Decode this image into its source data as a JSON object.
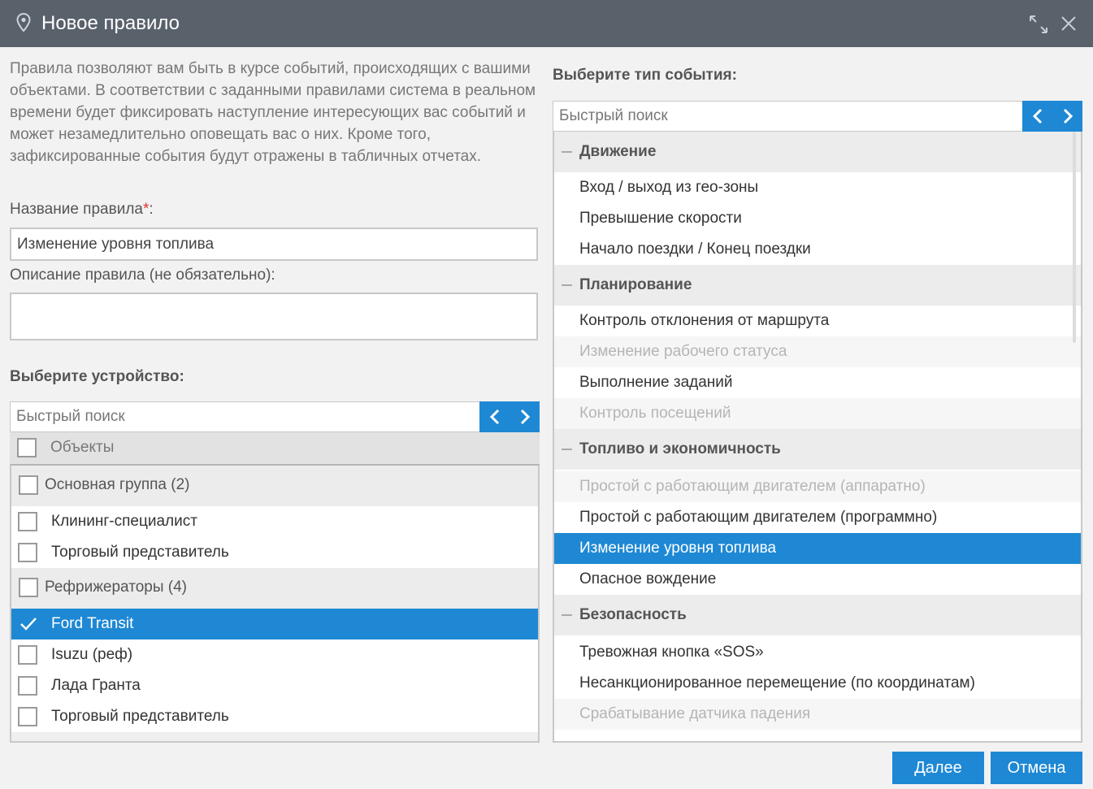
{
  "window": {
    "title": "Новое правило"
  },
  "description": "Правила позволяют вам быть в курсе событий, происходящих с вашими объектами. В соответствии с заданными правилами система в реальном времени будет фиксировать наступление интересующих вас событий и может незамедлительно оповещать вас о них. Кроме того, зафиксированные события будут отражены в табличных отчетах.",
  "form": {
    "name_label": "Название правила",
    "name_required_mark": "*",
    "name_colon": ":",
    "name_value": "Изменение уровня топлива",
    "desc_label": "Описание правила (не обязательно):",
    "desc_value": ""
  },
  "devices": {
    "title": "Выберите устройство:",
    "search_placeholder": "Быстрый поиск",
    "header_label": "Объекты",
    "groups": [
      {
        "label": "Основная группа (2)",
        "items": [
          "Клининг-специалист",
          "Торговый представитель"
        ]
      },
      {
        "label": "Рефрижераторы (4)",
        "items": [
          "Ford Transit",
          "Isuzu (реф)",
          "Лада Гранта",
          "Торговый представитель"
        ]
      }
    ],
    "selected": "Ford Transit"
  },
  "events": {
    "title": "Выберите тип события:",
    "search_placeholder": "Быстрый поиск",
    "categories": [
      {
        "label": "Движение",
        "items": [
          {
            "label": "Вход / выход из гео-зоны",
            "state": "enabled"
          },
          {
            "label": "Превышение скорости",
            "state": "enabled"
          },
          {
            "label": "Начало поездки / Конец поездки",
            "state": "enabled"
          }
        ]
      },
      {
        "label": "Планирование",
        "items": [
          {
            "label": "Контроль отклонения от маршрута",
            "state": "enabled"
          },
          {
            "label": "Изменение рабочего статуса",
            "state": "disabled"
          },
          {
            "label": "Выполнение заданий",
            "state": "enabled"
          },
          {
            "label": "Контроль посещений",
            "state": "disabled"
          }
        ]
      },
      {
        "label": "Топливо и экономичность",
        "items": [
          {
            "label": "Простой с работающим двигателем (аппаратно)",
            "state": "disabled"
          },
          {
            "label": "Простой с работающим двигателем (программно)",
            "state": "enabled"
          },
          {
            "label": "Изменение уровня топлива",
            "state": "selected"
          },
          {
            "label": "Опасное вождение",
            "state": "enabled"
          }
        ]
      },
      {
        "label": "Безопасность",
        "items": [
          {
            "label": "Тревожная кнопка «SOS»",
            "state": "enabled"
          },
          {
            "label": "Несанкционированное перемещение (по координатам)",
            "state": "enabled"
          },
          {
            "label": "Срабатывание датчика падения",
            "state": "disabled"
          }
        ]
      }
    ]
  },
  "buttons": {
    "next": "Далее",
    "cancel": "Отмена"
  },
  "colors": {
    "accent": "#1e88d4",
    "titlebar": "#59616b",
    "required": "#e0302c"
  }
}
